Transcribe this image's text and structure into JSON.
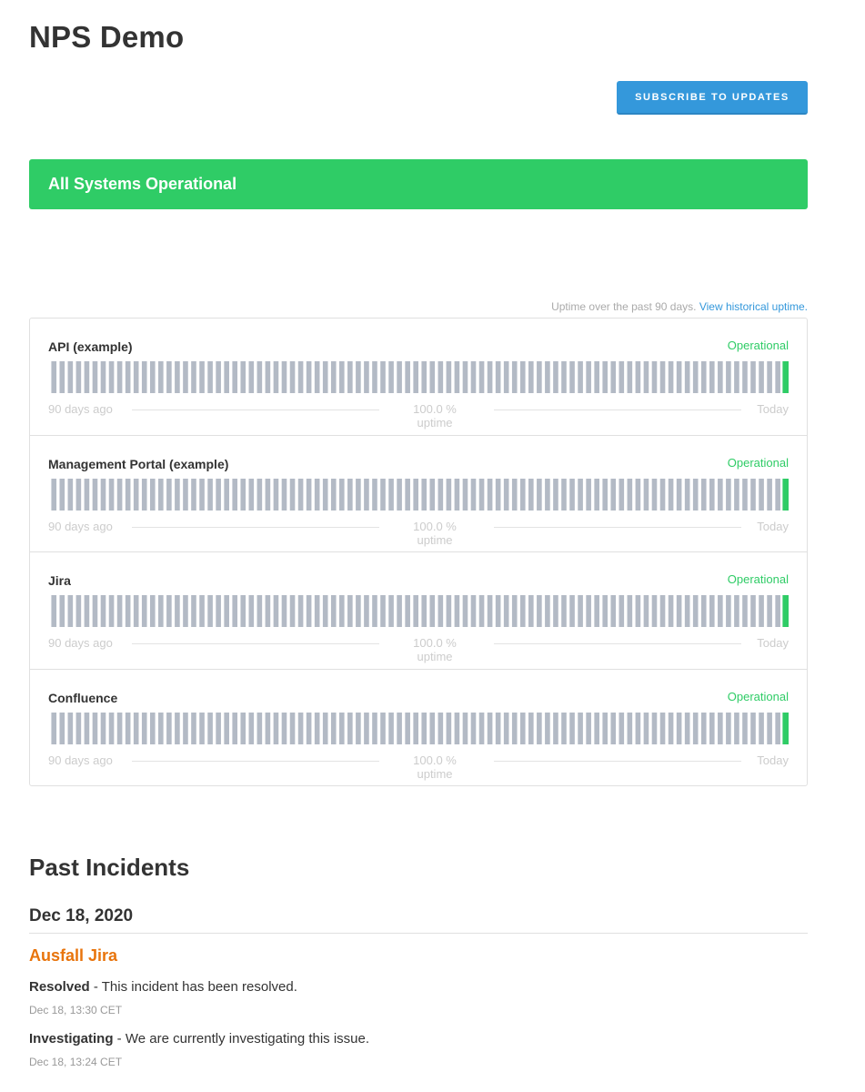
{
  "page": {
    "title": "NPS Demo",
    "subscribe_label": "SUBSCRIBE TO UPDATES"
  },
  "status_banner": {
    "text": "All Systems Operational",
    "color": "#2fcc66"
  },
  "uptime_caption": {
    "text": "Uptime over the past 90 days.",
    "link": "View historical uptime."
  },
  "colors": {
    "bar_idle": "#b3bac5",
    "bar_operational": "#2fcc66",
    "accent": "#3498db",
    "incident": "#e8740c"
  },
  "components": [
    {
      "name": "API (example)",
      "status": "Operational",
      "days": 90,
      "footer_left": "90 days ago",
      "uptime": "100.0 % uptime",
      "footer_right": "Today"
    },
    {
      "name": "Management Portal (example)",
      "status": "Operational",
      "days": 90,
      "footer_left": "90 days ago",
      "uptime": "100.0 % uptime",
      "footer_right": "Today"
    },
    {
      "name": "Jira",
      "status": "Operational",
      "days": 90,
      "footer_left": "90 days ago",
      "uptime": "100.0 % uptime",
      "footer_right": "Today"
    },
    {
      "name": "Confluence",
      "status": "Operational",
      "days": 90,
      "footer_left": "90 days ago",
      "uptime": "100.0 % uptime",
      "footer_right": "Today"
    }
  ],
  "past_incidents": {
    "title": "Past Incidents",
    "days": [
      {
        "date": "Dec 18, 2020",
        "incidents": [
          {
            "title": "Ausfall Jira",
            "updates": [
              {
                "status": "Resolved",
                "separator": " - ",
                "message": "This incident has been resolved.",
                "time": "Dec 18, 13:30 CET"
              },
              {
                "status": "Investigating",
                "separator": " - ",
                "message": "We are currently investigating this issue.",
                "time": "Dec 18, 13:24 CET"
              }
            ]
          }
        ]
      }
    ]
  }
}
